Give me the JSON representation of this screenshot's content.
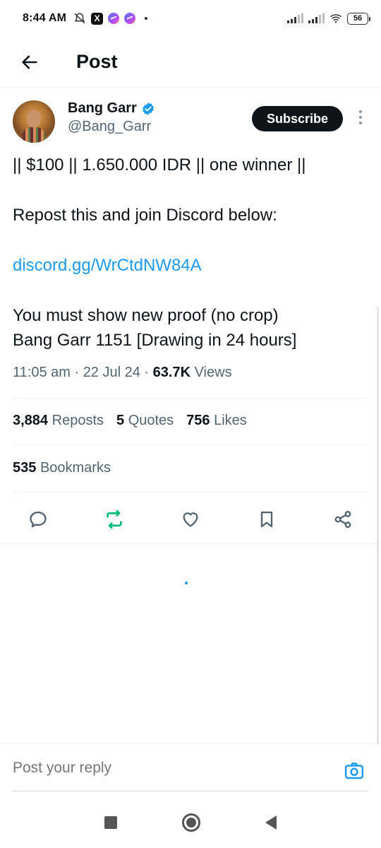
{
  "status_bar": {
    "time": "8:44 AM",
    "battery": "56"
  },
  "header": {
    "title": "Post"
  },
  "author": {
    "name": "Bang Garr",
    "handle": "@Bang_Garr",
    "subscribe_label": "Subscribe"
  },
  "post": {
    "line1": "|| $100 || 1.650.000 IDR || one winner ||",
    "line2": "Repost this and join Discord below:",
    "link": "discord.gg/WrCtdNW84A",
    "line3": "You must show new proof (no crop)",
    "line4": "Bang Garr 1151 [Drawing in 24 hours]"
  },
  "meta": {
    "time": "11:05 am",
    "date": "22 Jul 24",
    "views_count": "63.7K",
    "views_label": "Views"
  },
  "stats": {
    "reposts_count": "3,884",
    "reposts_label": "Reposts",
    "quotes_count": "5",
    "quotes_label": "Quotes",
    "likes_count": "756",
    "likes_label": "Likes",
    "bookmarks_count": "535",
    "bookmarks_label": "Bookmarks"
  },
  "reply": {
    "placeholder": "Post your reply"
  },
  "colors": {
    "accent": "#1d9bf0",
    "repost_green": "#00ba7c",
    "text_primary": "#0f1419",
    "text_secondary": "#536471"
  },
  "icons": [
    "back-arrow-icon",
    "verified-badge-icon",
    "more-icon",
    "reply-icon",
    "repost-icon",
    "like-icon",
    "bookmark-icon",
    "share-icon",
    "camera-icon"
  ]
}
